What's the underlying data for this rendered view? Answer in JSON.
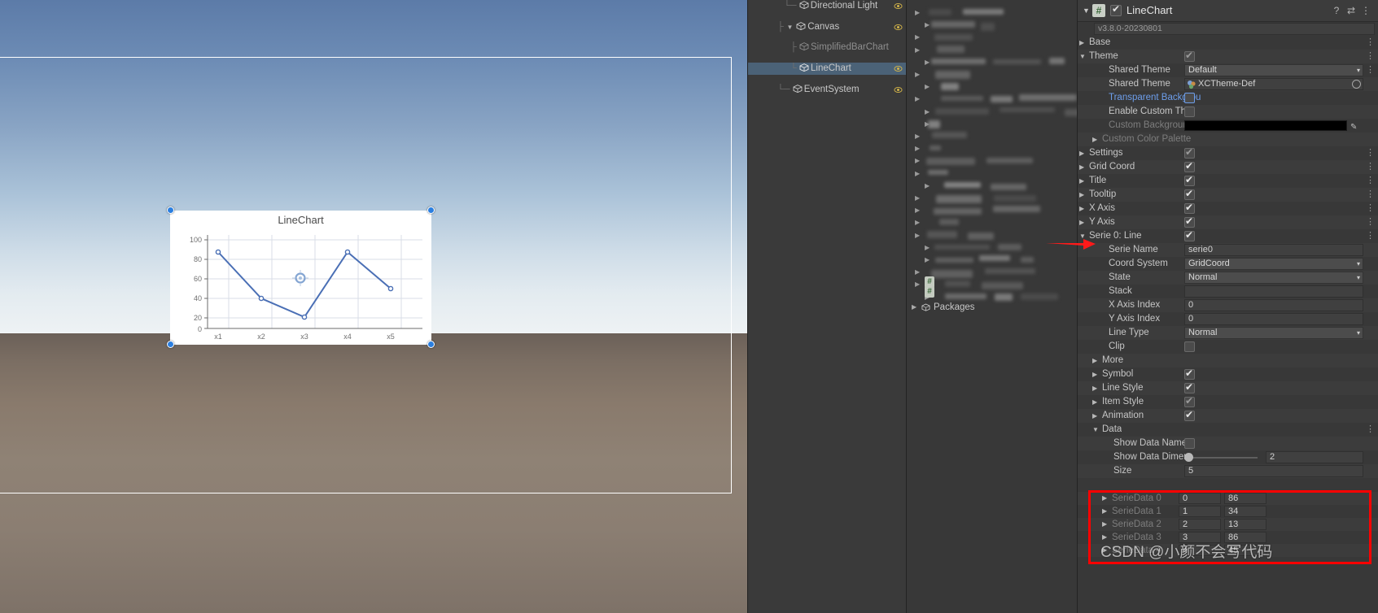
{
  "scene": {
    "canvas_selected": true
  },
  "chart": {
    "title": "LineChart",
    "y_ticks": [
      "100",
      "80",
      "60",
      "40",
      "20",
      "0"
    ],
    "x_ticks": [
      "x1",
      "x2",
      "x3",
      "x4",
      "x5"
    ],
    "accent_color": "#4a6fb5",
    "handle_color": "#2b7fe0"
  },
  "chart_data": {
    "type": "line",
    "title": "LineChart",
    "categories": [
      "x1",
      "x2",
      "x3",
      "x4",
      "x5"
    ],
    "series": [
      {
        "name": "serie0",
        "values": [
          86,
          34,
          13,
          86,
          45
        ]
      }
    ],
    "xlabel": "",
    "ylabel": "",
    "ylim": [
      0,
      100
    ],
    "yticks": [
      0,
      20,
      40,
      60,
      80,
      100
    ],
    "grid": true,
    "legend": false,
    "symbol": "circle",
    "line_color": "#4a6fb5"
  },
  "hierarchy": {
    "items": [
      {
        "label": "Directional Light",
        "depth": 2,
        "fold": "",
        "selected": false,
        "dim": false
      },
      {
        "label": "Canvas",
        "depth": 2,
        "fold": "▼",
        "selected": false,
        "dim": false
      },
      {
        "label": "SimplifiedBarChart",
        "depth": 3,
        "fold": "",
        "selected": false,
        "dim": true
      },
      {
        "label": "LineChart",
        "depth": 3,
        "fold": "",
        "selected": true,
        "dim": false
      },
      {
        "label": "EventSystem",
        "depth": 2,
        "fold": "",
        "selected": false,
        "dim": false
      }
    ]
  },
  "project": {
    "packages_label": "Packages"
  },
  "inspector": {
    "header": {
      "title": "LineChart",
      "enabled": true,
      "help_icon": "?",
      "preset_icon": "⇄",
      "menu_icon": "⋮"
    },
    "version": "v3.8.0-20230801",
    "rows": [
      {
        "name": "base",
        "label": "Base",
        "indent": 10,
        "fold": "▶",
        "type": "none",
        "kebab": true
      },
      {
        "name": "theme",
        "label": "Theme",
        "indent": 10,
        "fold": "▼",
        "type": "checkbox",
        "checked": true,
        "dimmed": true,
        "kebab": true
      },
      {
        "name": "shared-theme-1",
        "label": "Shared Theme",
        "indent": 34,
        "fold": "",
        "type": "dropdown",
        "value": "Default",
        "kebab": true
      },
      {
        "name": "shared-theme-2",
        "label": "Shared Theme",
        "indent": 34,
        "fold": "",
        "type": "object",
        "value": "XCTheme-Def",
        "kebab": false
      },
      {
        "name": "transparent-background",
        "label": "Transparent Backgrou",
        "indent": 34,
        "fold": "",
        "type": "checkbox-blue",
        "checked": false,
        "blue": true,
        "kebab": false
      },
      {
        "name": "enable-custom-theme",
        "label": "Enable Custom The",
        "indent": 34,
        "fold": "",
        "type": "checkbox",
        "checked": false,
        "kebab": false
      },
      {
        "name": "custom-background",
        "label": "Custom Backgroun",
        "indent": 34,
        "fold": "",
        "type": "color",
        "value": "#000000",
        "dim": true,
        "kebab": false
      },
      {
        "name": "custom-color-palette",
        "label": "Custom Color Palette",
        "indent": 26,
        "fold": "▶",
        "type": "none",
        "dim": true,
        "kebab": false
      },
      {
        "name": "settings",
        "label": "Settings",
        "indent": 10,
        "fold": "▶",
        "type": "checkbox",
        "checked": true,
        "dimmed": true,
        "kebab": true
      },
      {
        "name": "grid-coord",
        "label": "Grid Coord",
        "indent": 10,
        "fold": "▶",
        "type": "checkbox",
        "checked": true,
        "kebab": true
      },
      {
        "name": "title",
        "label": "Title",
        "indent": 10,
        "fold": "▶",
        "type": "checkbox",
        "checked": true,
        "kebab": true
      },
      {
        "name": "tooltip",
        "label": "Tooltip",
        "indent": 10,
        "fold": "▶",
        "type": "checkbox",
        "checked": true,
        "kebab": true
      },
      {
        "name": "x-axis",
        "label": "X Axis",
        "indent": 10,
        "fold": "▶",
        "type": "checkbox",
        "checked": true,
        "kebab": true
      },
      {
        "name": "y-axis",
        "label": "Y Axis",
        "indent": 10,
        "fold": "▶",
        "type": "checkbox",
        "checked": true,
        "kebab": true
      },
      {
        "name": "serie-0-line",
        "label": "Serie 0: Line",
        "indent": 10,
        "fold": "▼",
        "type": "checkbox",
        "checked": true,
        "kebab": true
      },
      {
        "name": "serie-name",
        "label": "Serie Name",
        "indent": 34,
        "fold": "",
        "type": "text",
        "value": "serie0",
        "kebab": false
      },
      {
        "name": "coord-system",
        "label": "Coord System",
        "indent": 34,
        "fold": "",
        "type": "dropdown",
        "value": "GridCoord",
        "kebab": false
      },
      {
        "name": "state",
        "label": "State",
        "indent": 34,
        "fold": "",
        "type": "dropdown",
        "value": "Normal",
        "kebab": false
      },
      {
        "name": "stack",
        "label": "Stack",
        "indent": 34,
        "fold": "",
        "type": "text",
        "value": "",
        "kebab": false
      },
      {
        "name": "x-axis-index",
        "label": "X Axis Index",
        "indent": 34,
        "fold": "",
        "type": "text",
        "value": "0",
        "kebab": false
      },
      {
        "name": "y-axis-index",
        "label": "Y Axis Index",
        "indent": 34,
        "fold": "",
        "type": "text",
        "value": "0",
        "kebab": false
      },
      {
        "name": "line-type",
        "label": "Line Type",
        "indent": 34,
        "fold": "",
        "type": "dropdown",
        "value": "Normal",
        "kebab": false
      },
      {
        "name": "clip",
        "label": "Clip",
        "indent": 34,
        "fold": "",
        "type": "checkbox",
        "checked": false,
        "kebab": false
      },
      {
        "name": "more",
        "label": "More",
        "indent": 26,
        "fold": "▶",
        "type": "none",
        "kebab": false
      },
      {
        "name": "symbol",
        "label": "Symbol",
        "indent": 26,
        "fold": "▶",
        "type": "checkbox",
        "checked": true,
        "kebab": false
      },
      {
        "name": "line-style",
        "label": "Line Style",
        "indent": 26,
        "fold": "▶",
        "type": "checkbox",
        "checked": true,
        "kebab": false
      },
      {
        "name": "item-style",
        "label": "Item Style",
        "indent": 26,
        "fold": "▶",
        "type": "checkbox",
        "checked": true,
        "dimmed": true,
        "kebab": false
      },
      {
        "name": "animation",
        "label": "Animation",
        "indent": 26,
        "fold": "▶",
        "type": "checkbox",
        "checked": true,
        "kebab": false
      },
      {
        "name": "data",
        "label": "Data",
        "indent": 26,
        "fold": "▼",
        "type": "none",
        "kebab": true
      },
      {
        "name": "show-data-name",
        "label": "Show Data Name",
        "indent": 40,
        "fold": "",
        "type": "checkbox",
        "checked": false,
        "kebab": false
      },
      {
        "name": "show-data-dimension",
        "label": "Show Data Dimen",
        "indent": 40,
        "fold": "",
        "type": "slider",
        "value": "2",
        "kebab": false
      },
      {
        "name": "size",
        "label": "Size",
        "indent": 40,
        "fold": "",
        "type": "text",
        "value": "5",
        "kebab": false
      }
    ],
    "serie_data": {
      "header_label": "SerieData",
      "rows": [
        {
          "label": "SerieData 0",
          "x": "0",
          "y": "86"
        },
        {
          "label": "SerieData 1",
          "x": "1",
          "y": "34"
        },
        {
          "label": "SerieData 2",
          "x": "2",
          "y": "13"
        },
        {
          "label": "SerieData 3",
          "x": "3",
          "y": "86"
        },
        {
          "label": "SerieData 4",
          "x": "4",
          "y": "45"
        }
      ]
    },
    "annotation_color": "#ff0000"
  },
  "watermark": {
    "text": "CSDN @小颜不会写代码",
    "bottom_text": ""
  }
}
